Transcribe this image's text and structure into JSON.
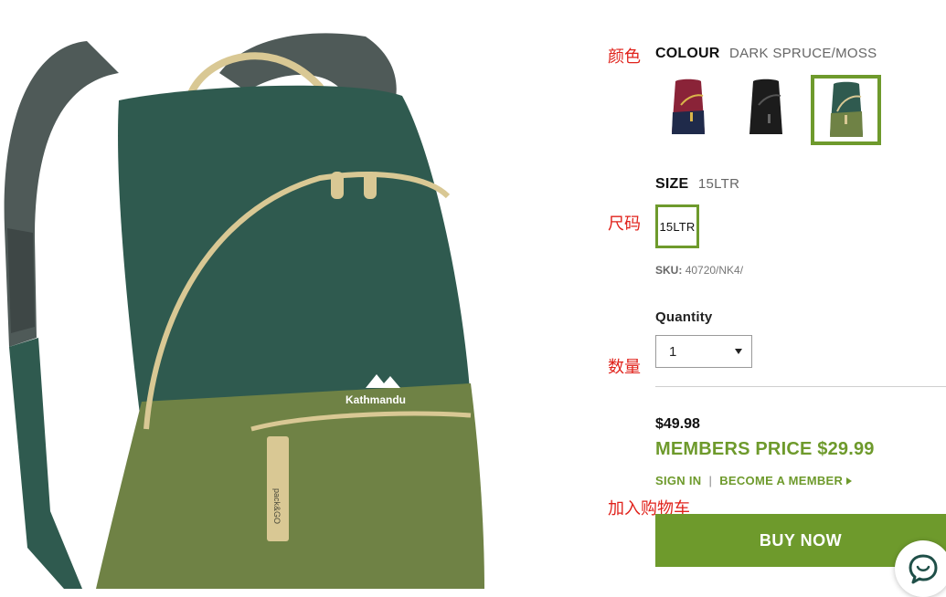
{
  "annotations": {
    "colour": "颜色",
    "size": "尺码",
    "quantity": "数量",
    "add_to_cart": "加入购物车"
  },
  "colour": {
    "label": "COLOUR",
    "value": "DARK SPRUCE/MOSS",
    "swatches": [
      {
        "name": "red-navy",
        "colors": [
          "#8a2338",
          "#1f2a4a"
        ],
        "selected": false
      },
      {
        "name": "black",
        "colors": [
          "#1c1c1c",
          "#2a2a2a"
        ],
        "selected": false
      },
      {
        "name": "dark-spruce-moss",
        "colors": [
          "#2f5a4f",
          "#6f8245"
        ],
        "selected": true
      }
    ]
  },
  "size": {
    "label": "SIZE",
    "value": "15LTR",
    "options": [
      "15LTR"
    ]
  },
  "sku": {
    "label": "SKU:",
    "value": "40720/NK4/"
  },
  "quantity": {
    "label": "Quantity",
    "value": "1"
  },
  "pricing": {
    "price": "$49.98",
    "members_price": "MEMBERS PRICE $29.99",
    "sign_in": "SIGN IN",
    "separator": "|",
    "become_member": "BECOME A MEMBER"
  },
  "buy_now": "BUY NOW",
  "product": {
    "brand_text": "Kathmandu",
    "tag_text": "pack&GO"
  },
  "colors": {
    "accent": "#6e9a2c",
    "annotation": "#e0221b",
    "backpack_top": "#2f5a4f",
    "backpack_bottom": "#6f8245"
  }
}
